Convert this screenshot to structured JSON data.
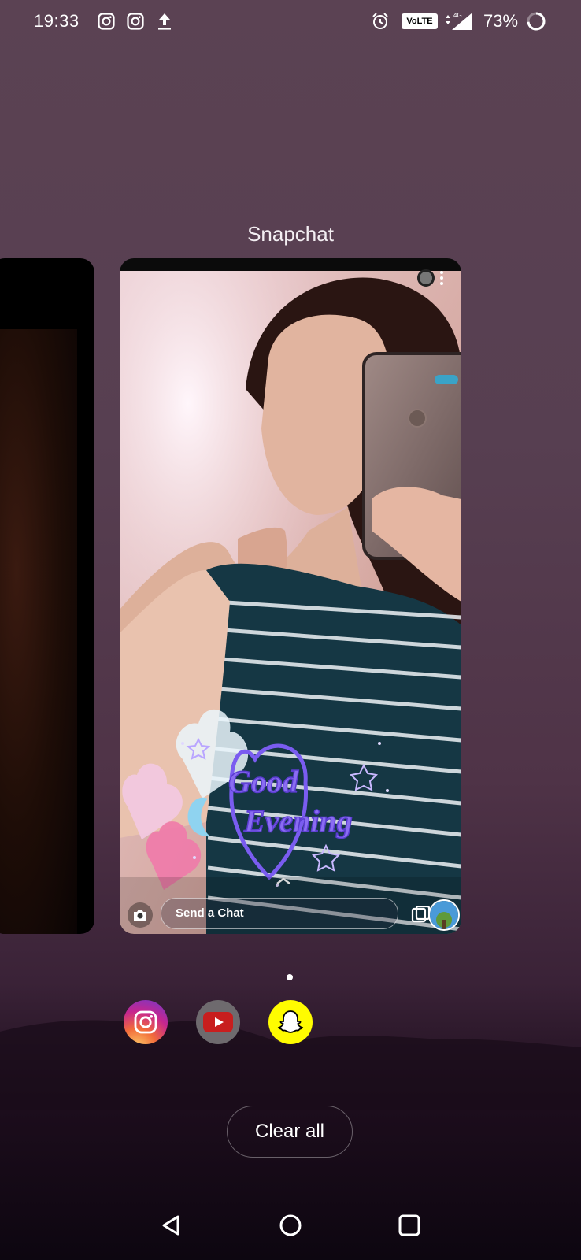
{
  "status_bar": {
    "time": "19:33",
    "notification_icons": [
      "instagram-icon",
      "instagram-icon",
      "upload-icon"
    ],
    "network_badge": "VoLTE",
    "network_type": "4G",
    "battery_percent": "73%"
  },
  "recents": {
    "current_app_label": "Snapchat",
    "snapchat_preview": {
      "chat_placeholder": "Send a Chat",
      "sticker_text_line1": "Good",
      "sticker_text_line2": "Evening"
    },
    "page_indicator_active": 0,
    "dock_apps": [
      {
        "name": "Instagram",
        "icon": "instagram-icon"
      },
      {
        "name": "YouTube",
        "icon": "youtube-icon"
      },
      {
        "name": "Snapchat",
        "icon": "snapchat-icon"
      }
    ],
    "clear_all_label": "Clear all"
  },
  "nav_bar": {
    "buttons": [
      "back-icon",
      "home-icon",
      "recents-icon"
    ]
  },
  "colors": {
    "snapchat_yellow": "#FFFC00",
    "youtube_red": "#CC0000",
    "sticker_purple": "#6a4fd8"
  }
}
